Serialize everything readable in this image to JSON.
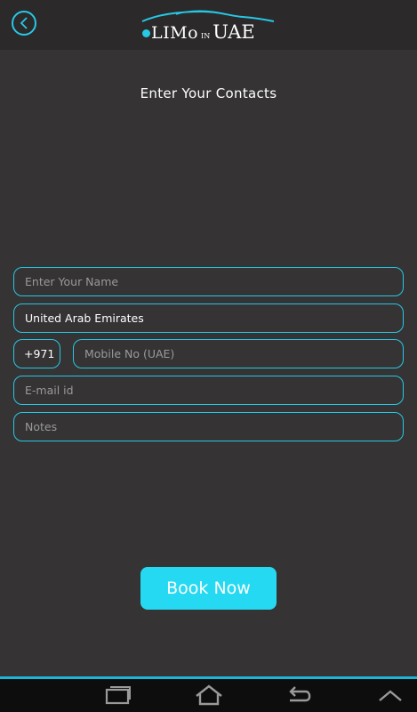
{
  "header": {
    "back_icon": "chevron-left-icon",
    "logo": {
      "main": "LIMo",
      "in": "IN",
      "uae": "UAE"
    }
  },
  "form": {
    "title": "Enter Your Contacts",
    "name_placeholder": "Enter Your Name",
    "country_value": "United Arab Emirates",
    "country_code": "+971",
    "mobile_placeholder": "Mobile No (UAE)",
    "email_placeholder": "E-mail id",
    "notes_placeholder": "Notes",
    "submit_label": "Book Now"
  },
  "navbar": {
    "icons": [
      "recent-apps-icon",
      "home-icon",
      "back-icon",
      "chevron-up-icon"
    ]
  },
  "colors": {
    "background": "#353333",
    "accent": "#26c8e6",
    "button": "#26d9f2"
  }
}
